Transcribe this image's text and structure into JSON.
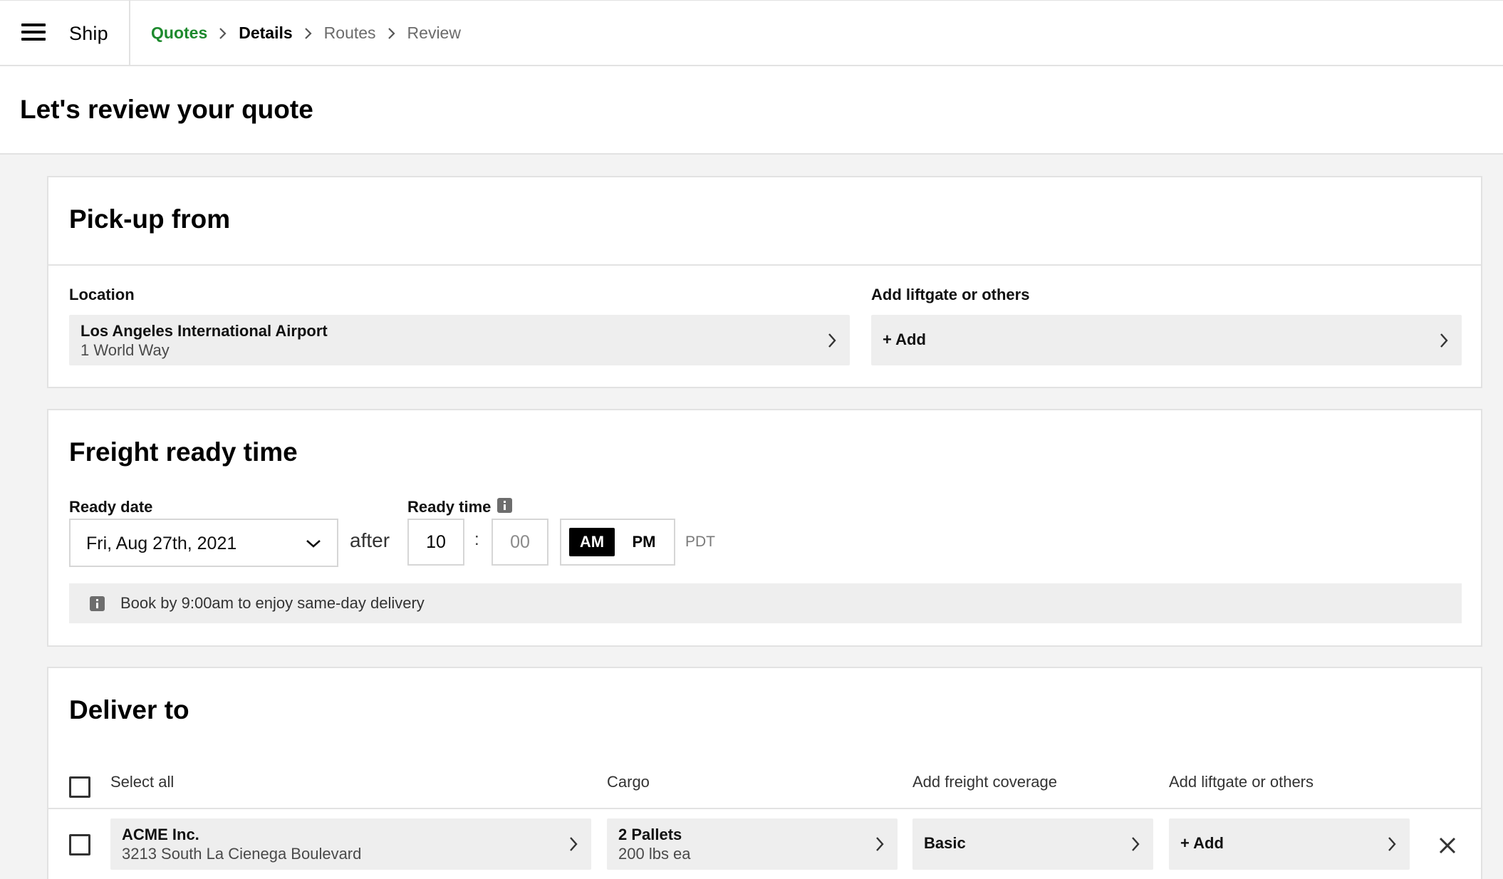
{
  "app": {
    "name": "Ship"
  },
  "breadcrumb": [
    {
      "label": "Quotes"
    },
    {
      "label": "Details"
    },
    {
      "label": "Routes"
    },
    {
      "label": "Review"
    }
  ],
  "page": {
    "title": "Let's review your quote"
  },
  "pickup": {
    "title": "Pick-up from",
    "location_label": "Location",
    "location_name": "Los Angeles International Airport",
    "location_address": "1 World Way",
    "extras_label": "Add liftgate or others",
    "extras_value": "+ Add"
  },
  "ready": {
    "title": "Freight ready time",
    "date_label": "Ready date",
    "date_value": "Fri, Aug 27th, 2021",
    "after": "after",
    "time_label": "Ready time",
    "hour": "10",
    "colon": ":",
    "minute_placeholder": "00",
    "am": "AM",
    "pm": "PM",
    "selected_period": "AM",
    "timezone": "PDT",
    "notice": "Book by 9:00am to enjoy same-day delivery"
  },
  "deliver": {
    "title": "Deliver to",
    "select_all": "Select all",
    "col_cargo": "Cargo",
    "col_coverage": "Add freight coverage",
    "col_extras": "Add liftgate or others",
    "rows": [
      {
        "name": "ACME Inc.",
        "address": "3213 South La Cienega Boulevard",
        "cargo_primary": "2 Pallets",
        "cargo_secondary": "200 lbs ea",
        "coverage": "Basic",
        "extras": "+ Add"
      }
    ]
  },
  "colors": {
    "accent": "#1e8a2e",
    "card_bg": "#ffffff",
    "page_bg": "#f3f3f3",
    "field_bg": "#eeeeee"
  },
  "icons": [
    "menu-icon",
    "chevron-right-icon",
    "chevron-down-icon",
    "info-icon",
    "checkbox-icon",
    "close-icon"
  ]
}
